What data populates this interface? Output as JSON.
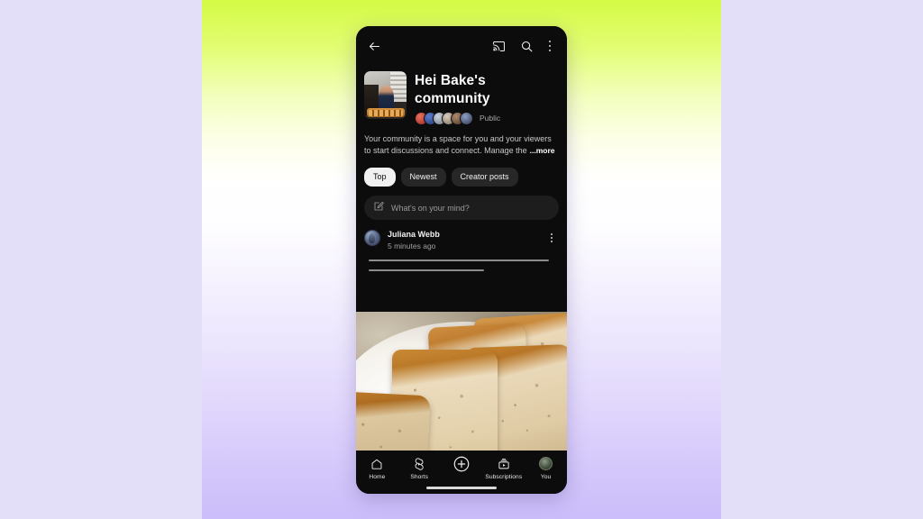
{
  "theme": {
    "page_background": "#E4DFF8",
    "panel_gradient_top": "#D4FA45",
    "panel_gradient_mid": "#FFFFFF",
    "panel_gradient_bottom": "#CBBDFA",
    "phone_background": "#0C0C0C",
    "accent_text": "#F1F1F1",
    "muted_text": "#A6A6A6"
  },
  "appbar": {
    "back_icon": "back-arrow-icon",
    "cast_icon": "cast-icon",
    "search_icon": "search-icon",
    "overflow_icon": "kebab-menu-icon"
  },
  "channel": {
    "thumbnail_alt": "channel-thumbnail",
    "title": "Hei Bake's community",
    "visibility": "Public",
    "member_avatar_count": 6,
    "description": "Your community is a space for you and your viewers to start discussions and connect. Manage the",
    "more_label": "...more"
  },
  "filters": {
    "tabs": [
      {
        "label": "Top",
        "selected": true
      },
      {
        "label": "Newest",
        "selected": false
      },
      {
        "label": "Creator posts",
        "selected": false
      }
    ]
  },
  "composer": {
    "icon": "compose-pencil-icon",
    "placeholder": "What's on your mind?"
  },
  "post": {
    "avatar_alt": "post-author-avatar",
    "author": "Juliana Webb",
    "timestamp": "5 minutes ago",
    "overflow_icon": "kebab-menu-icon",
    "body_placeholder_lines": 2,
    "image_alt": "sliced banana bread on a white plate"
  },
  "bottom_nav": {
    "items": [
      {
        "label": "Home",
        "icon": "home-icon"
      },
      {
        "label": "Shorts",
        "icon": "shorts-icon"
      },
      {
        "label": "",
        "icon": "create-plus-icon"
      },
      {
        "label": "Subscriptions",
        "icon": "subscriptions-icon"
      },
      {
        "label": "You",
        "icon": "account-avatar-icon"
      }
    ],
    "home_indicator": true
  }
}
